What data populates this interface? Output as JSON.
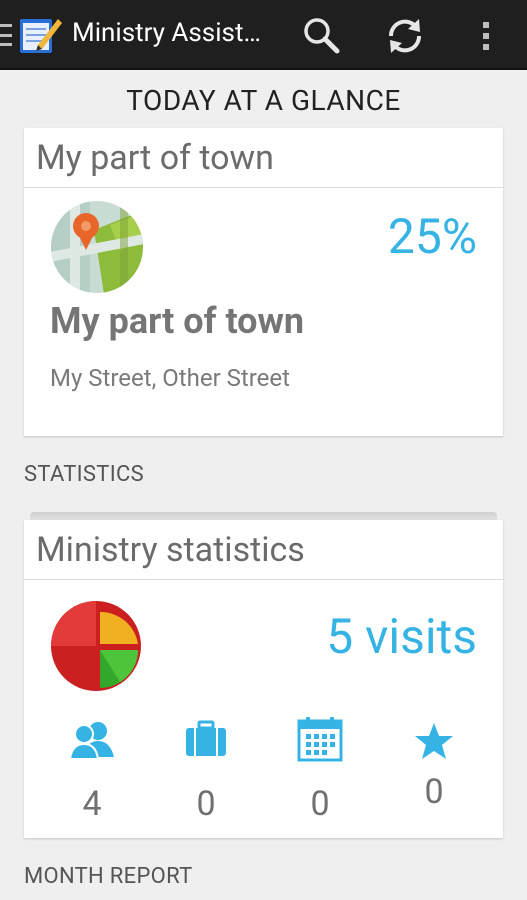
{
  "actionbar": {
    "title": "Ministry Assist…",
    "icons": [
      "menu-icon",
      "app-notepad-icon",
      "search-icon",
      "sync-icon",
      "overflow-menu-icon"
    ]
  },
  "header": "TODAY AT A GLANCE",
  "territory_card": {
    "title": "My part of town",
    "progress": "25%",
    "name": "My part of town",
    "streets": "My Street, Other Street"
  },
  "statistics_label": "STATISTICS",
  "stats_card": {
    "title": "Ministry statistics",
    "visits": "5 visits",
    "items": [
      {
        "icon": "people-icon",
        "value": "4"
      },
      {
        "icon": "briefcase-icon",
        "value": "0"
      },
      {
        "icon": "calendar-icon",
        "value": "0"
      },
      {
        "icon": "star-icon",
        "value": "0"
      }
    ]
  },
  "month_report_label": "MONTH REPORT",
  "colors": {
    "accent": "#35b3e5",
    "actionbar": "#1f1f1f"
  }
}
